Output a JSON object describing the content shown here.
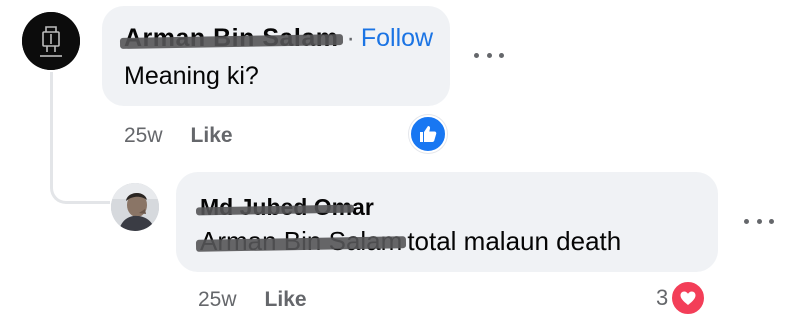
{
  "comment": {
    "author": "Arman Bin Salam",
    "separator": "·",
    "follow_label": "Follow",
    "text": "Meaning ki?",
    "time": "25w",
    "like_label": "Like",
    "reaction_icon": "like-icon",
    "more_icon": "more-options-icon"
  },
  "reply": {
    "author": "Md Jubed Omar",
    "mention": "Arman Bin Salam",
    "text": "total malaun death",
    "time": "25w",
    "like_label": "Like",
    "reaction_count": "3",
    "reaction_icon": "love-icon",
    "more_icon": "more-options-icon"
  },
  "colors": {
    "bubble": "#f0f2f5",
    "link": "#1b74e4",
    "meta": "#65676b",
    "like_reaction": "#1877f2",
    "love_reaction": "#f33e58"
  }
}
